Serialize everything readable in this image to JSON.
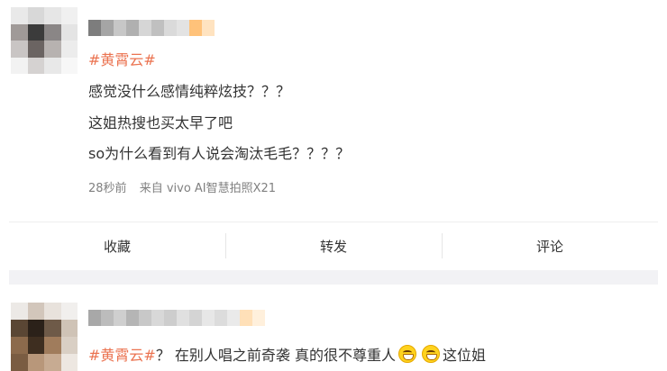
{
  "post1": {
    "topic": "#黄霄云#",
    "lines": [
      "感觉没什么感情纯粹炫技？？？",
      "这姐热搜也买太早了吧",
      "so为什么看到有人说会淘汰毛毛？？？？"
    ],
    "time": "28秒前",
    "source": "来自 vivo AI智慧拍照X21"
  },
  "actions": {
    "favorite": "收藏",
    "repost": "转发",
    "comment": "评论"
  },
  "post2": {
    "topic": "#黄霄云#",
    "text_before": "？ 在别人唱之前奇袭 真的很不尊重人",
    "text_after": "这位姐",
    "emoji": "grinning-face-emoji"
  }
}
